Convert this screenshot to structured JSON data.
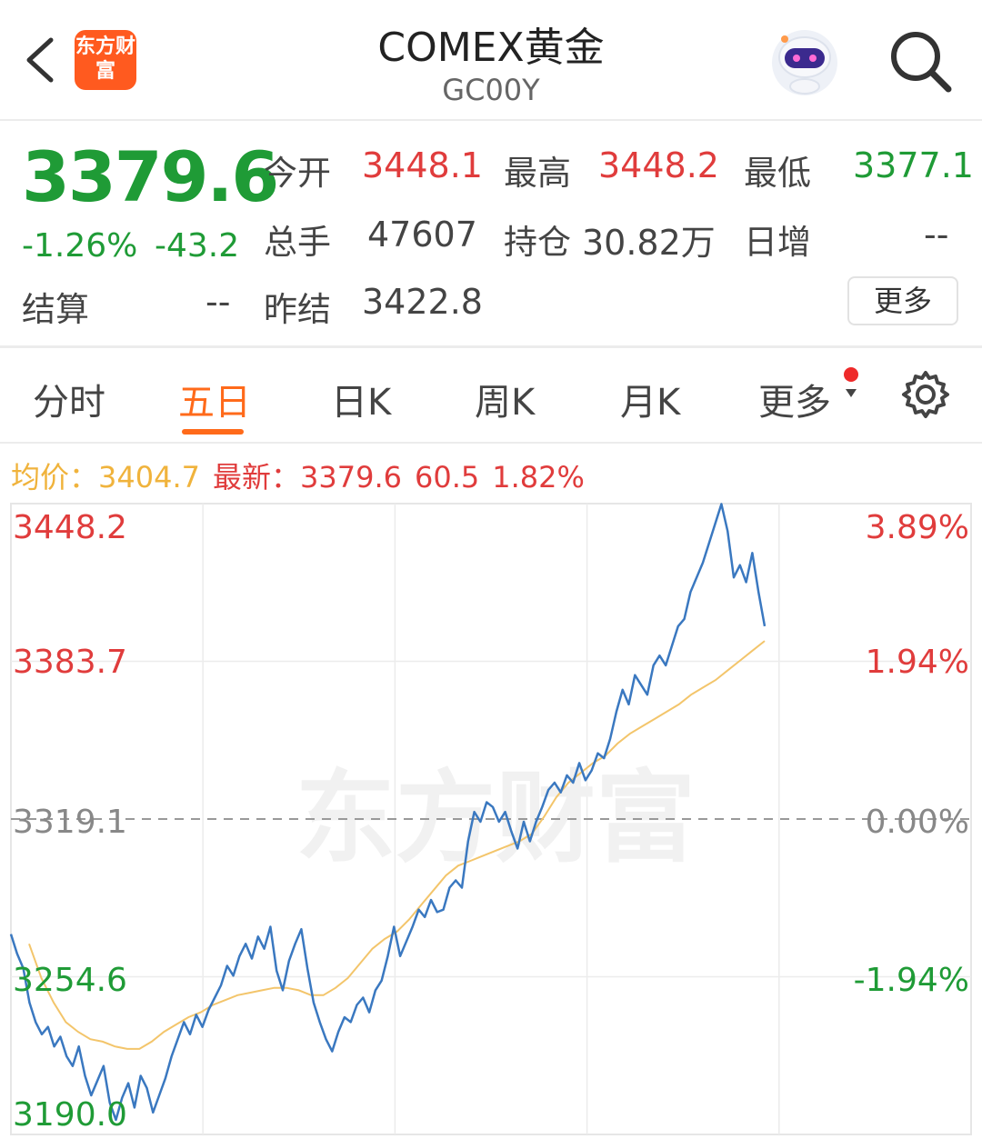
{
  "header": {
    "title": "COMEX黄金",
    "subtitle": "GC00Y",
    "logo_text": "东方财富"
  },
  "quote": {
    "price": "3379.6",
    "change_pct": "-1.26%",
    "change": "-43.2",
    "open_label": "今开",
    "open": "3448.1",
    "high_label": "最高",
    "high": "3448.2",
    "low_label": "最低",
    "low": "3377.1",
    "volume_label": "总手",
    "volume": "47607",
    "oi_label": "持仓",
    "oi": "30.82万",
    "daily_inc_label": "日增",
    "daily_inc": "--",
    "settle_label": "结算",
    "settle": "--",
    "prev_settle_label": "昨结",
    "prev_settle": "3422.8",
    "more_button": "更多"
  },
  "tabs": [
    "分时",
    "五日",
    "日K",
    "周K",
    "月K",
    "更多"
  ],
  "active_tab": 1,
  "info": {
    "avg_label": "均价：3404.7",
    "latest_label": "最新：",
    "latest": "3379.6",
    "diff": "60.5",
    "diff_pct": "1.82%"
  },
  "colors": {
    "up": "#e03c3c",
    "down": "#1f9b36",
    "price_line": "#3a78c0",
    "avg_line": "#f3c56b",
    "accent": "#ff6a1a"
  },
  "chart_data": {
    "type": "line",
    "y_ticks": [
      "3448.2",
      "3383.7",
      "3319.1",
      "3254.6",
      "3190.0"
    ],
    "pct_ticks": [
      "3.89%",
      "1.94%",
      "0.00%",
      "-1.94%",
      "-1.94%"
    ],
    "pct_ticks_display": [
      "3.89%",
      "1.94%",
      "0.00%",
      "-1.94%"
    ],
    "ylim": [
      3190.0,
      3448.2
    ],
    "base": 3319.1,
    "days": 5,
    "series": [
      {
        "values": [
          3272,
          3264,
          3258,
          3244,
          3236,
          3231,
          3234,
          3226,
          3230,
          3222,
          3218,
          3226,
          3214,
          3206,
          3212,
          3218,
          3203,
          3196,
          3205,
          3211,
          3201,
          3214,
          3209,
          3199,
          3206,
          3213,
          3222,
          3229,
          3236,
          3231,
          3239,
          3234,
          3241,
          3246,
          3251,
          3259,
          3255,
          3263,
          3268,
          3262,
          3271,
          3266,
          3275,
          3257,
          3249,
          3261,
          3268,
          3274,
          3258,
          3244,
          3236,
          3229,
          3224,
          3232,
          3238,
          3236,
          3243,
          3246,
          3240,
          3249,
          3253,
          3263,
          3275,
          3263,
          3269,
          3275,
          3282,
          3279,
          3286,
          3281,
          3282,
          3291,
          3294,
          3291,
          3310,
          3322,
          3318,
          3326,
          3324,
          3318,
          3322,
          3314,
          3307,
          3318,
          3310,
          3318,
          3324,
          3331,
          3334,
          3330,
          3337,
          3334,
          3342,
          3335,
          3339,
          3346,
          3344,
          3352,
          3363,
          3372,
          3366,
          3378,
          3374,
          3370,
          3382,
          3386,
          3382,
          3390,
          3398,
          3401,
          3412,
          3418,
          3424,
          3432,
          3440,
          3448,
          3437,
          3418,
          3423,
          3416,
          3428,
          3412,
          3398
        ],
        "avg": [
          3268,
          3254,
          3244,
          3236,
          3232,
          3229,
          3228,
          3226,
          3225,
          3225,
          3228,
          3232,
          3235,
          3238,
          3240,
          3243,
          3245,
          3247,
          3248,
          3249,
          3250,
          3250,
          3249,
          3247,
          3247,
          3250,
          3254,
          3260,
          3266,
          3270,
          3273,
          3278,
          3284,
          3290,
          3296,
          3300,
          3302,
          3304,
          3306,
          3308,
          3310,
          3313,
          3320,
          3328,
          3334,
          3338,
          3342,
          3345,
          3350,
          3354,
          3357,
          3360,
          3363,
          3366,
          3370,
          3373,
          3376,
          3380,
          3384,
          3388,
          3392
        ]
      }
    ]
  },
  "watermark": "东方财富"
}
